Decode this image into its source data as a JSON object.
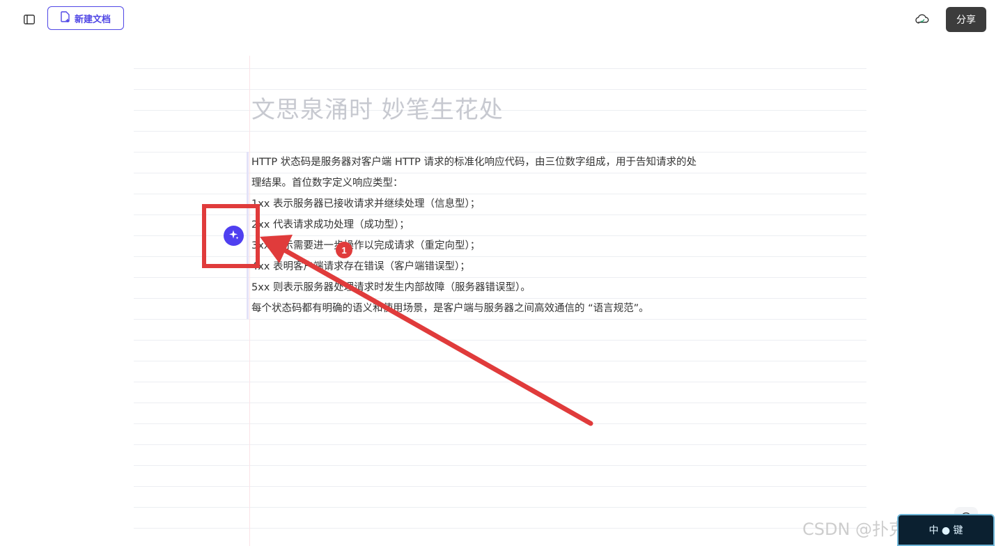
{
  "toolbar": {
    "sidebar_toggle_icon": "sidebar-panel-icon",
    "new_doc_label": "新建文档",
    "new_doc_icon": "file-plus-icon",
    "cloud_icon": "cloud-sync-icon",
    "share_label": "分享"
  },
  "document": {
    "title_placeholder": "文思泉涌时 妙笔生花处",
    "lines": [
      "HTTP 状态码是服务器对客户端 HTTP 请求的标准化响应代码，由三位数字组成，用于告知请求的处",
      "理结果。首位数字定义响应类型：",
      "1xx 表示服务器已接收请求并继续处理（信息型）；",
      "2xx 代表请求成功处理（成功型）；",
      "3xx 指示需要进一步操作以完成请求（重定向型）；",
      "4xx 表明客户端请求存在错误（客户端错误型）；",
      "5xx 则表示服务器处理请求时发生内部故障（服务器错误型）。",
      "每个状态码都有明确的语义和使用场景，是客户端与服务器之间高效通信的 “语言规范”。"
    ]
  },
  "ai_assistant": {
    "icon": "sparkle-icon"
  },
  "annotation": {
    "step_number": "1",
    "color": "#e03b3b"
  },
  "help": {
    "icon": "help-icon"
  },
  "watermark": {
    "text": "CSDN @扑克中的黑桃A"
  },
  "sticker": {
    "text": "中 ● 键"
  },
  "colors": {
    "accent": "#4f46e5",
    "ai_button": "#4f3ff0",
    "share_bg": "#3c3c3c",
    "title_placeholder": "#c7c9d0"
  }
}
